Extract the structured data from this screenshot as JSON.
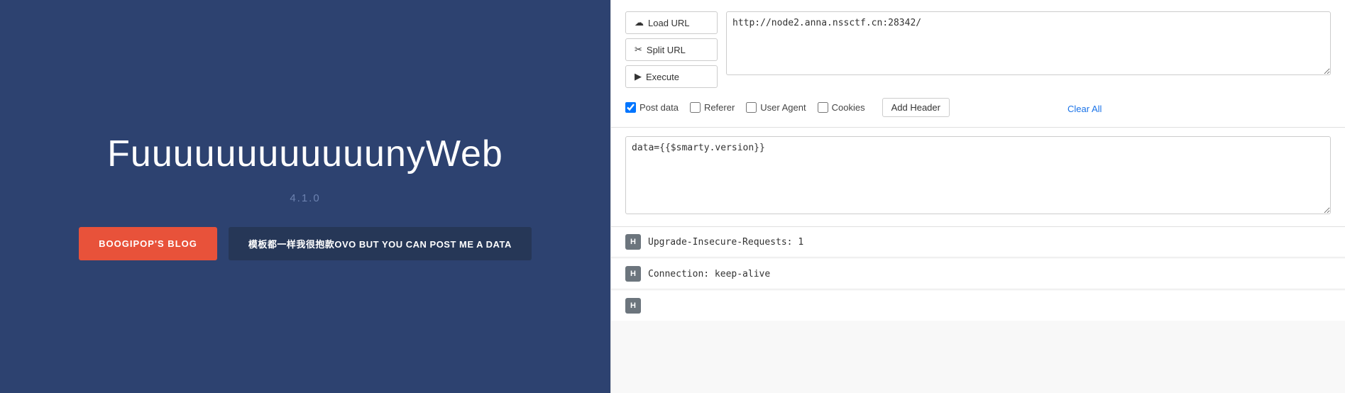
{
  "left": {
    "title": "FuuuuuuuuuuuunyWeb",
    "version": "4.1.0",
    "blog_button": "BOOGIPOP'S BLOG",
    "info_button": "模板都一样我很抱款OVO BUT YOU CAN POST ME A DATA"
  },
  "right": {
    "load_url_label": "Load URL",
    "split_url_label": "Split URL",
    "execute_label": "Execute",
    "url_value": "http://node2.anna.nssctf.cn:28342/",
    "checkboxes": {
      "post_data": {
        "label": "Post data",
        "checked": true
      },
      "referer": {
        "label": "Referer",
        "checked": false
      },
      "user_agent": {
        "label": "User Agent",
        "checked": false
      },
      "cookies": {
        "label": "Cookies",
        "checked": false
      }
    },
    "clear_all_label": "Clear All",
    "add_header_label": "Add Header",
    "post_data_value": "data={{$smarty.version}}",
    "headers": [
      {
        "badge": "H",
        "value": "Upgrade-Insecure-Requests: 1"
      },
      {
        "badge": "H",
        "value": "Connection: keep-alive"
      }
    ],
    "partial_header": {
      "badge": "H",
      "value": ""
    }
  },
  "icons": {
    "load": "☁",
    "split": "✂",
    "execute": "▶"
  }
}
